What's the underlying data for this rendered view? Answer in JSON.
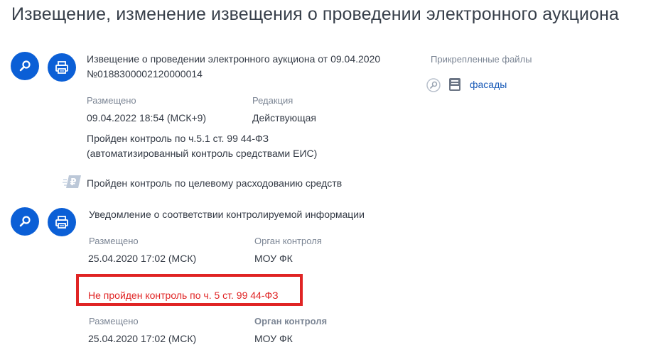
{
  "page": {
    "title": "Извещение, изменение извещения о проведении электронного аукциона"
  },
  "notice": {
    "title_line1": "Извещение о проведении электронного аукциона от 09.04.2020",
    "title_line2": "№0188300002120000014",
    "placed_label": "Размещено",
    "placed_value": "09.04.2022 18:54 (МСК+9)",
    "edition_label": "Редакция",
    "edition_value": "Действующая",
    "control_line1": "Пройден контроль по ч.5.1 ст. 99 44-ФЗ",
    "control_line2": "(автоматизированный контроль средствами ЕИС)",
    "funds_control": "Пройден контроль по целевому расходованию средств"
  },
  "files": {
    "title": "Прикрепленные файлы",
    "items": [
      {
        "name": "фасады"
      }
    ]
  },
  "notification": {
    "title": "Уведомление о соответствии контролируемой информации",
    "placed_label": "Размещено",
    "placed_value": "25.04.2020  17:02 (МСК)",
    "organ_label": "Орган контроля",
    "organ_value": "МОУ ФК",
    "failed_control": "Не пройден контроль по ч. 5 ст. 99 44-ФЗ",
    "placed_label_2": "Размещено",
    "placed_value_2": "25.04.2020  17:02 (МСК)",
    "organ_label_2": "Орган контроля",
    "organ_value_2": "МОУ ФК"
  },
  "colors": {
    "accent": "#0b5fd6",
    "link": "#1a5bb8",
    "error": "#e02424"
  }
}
